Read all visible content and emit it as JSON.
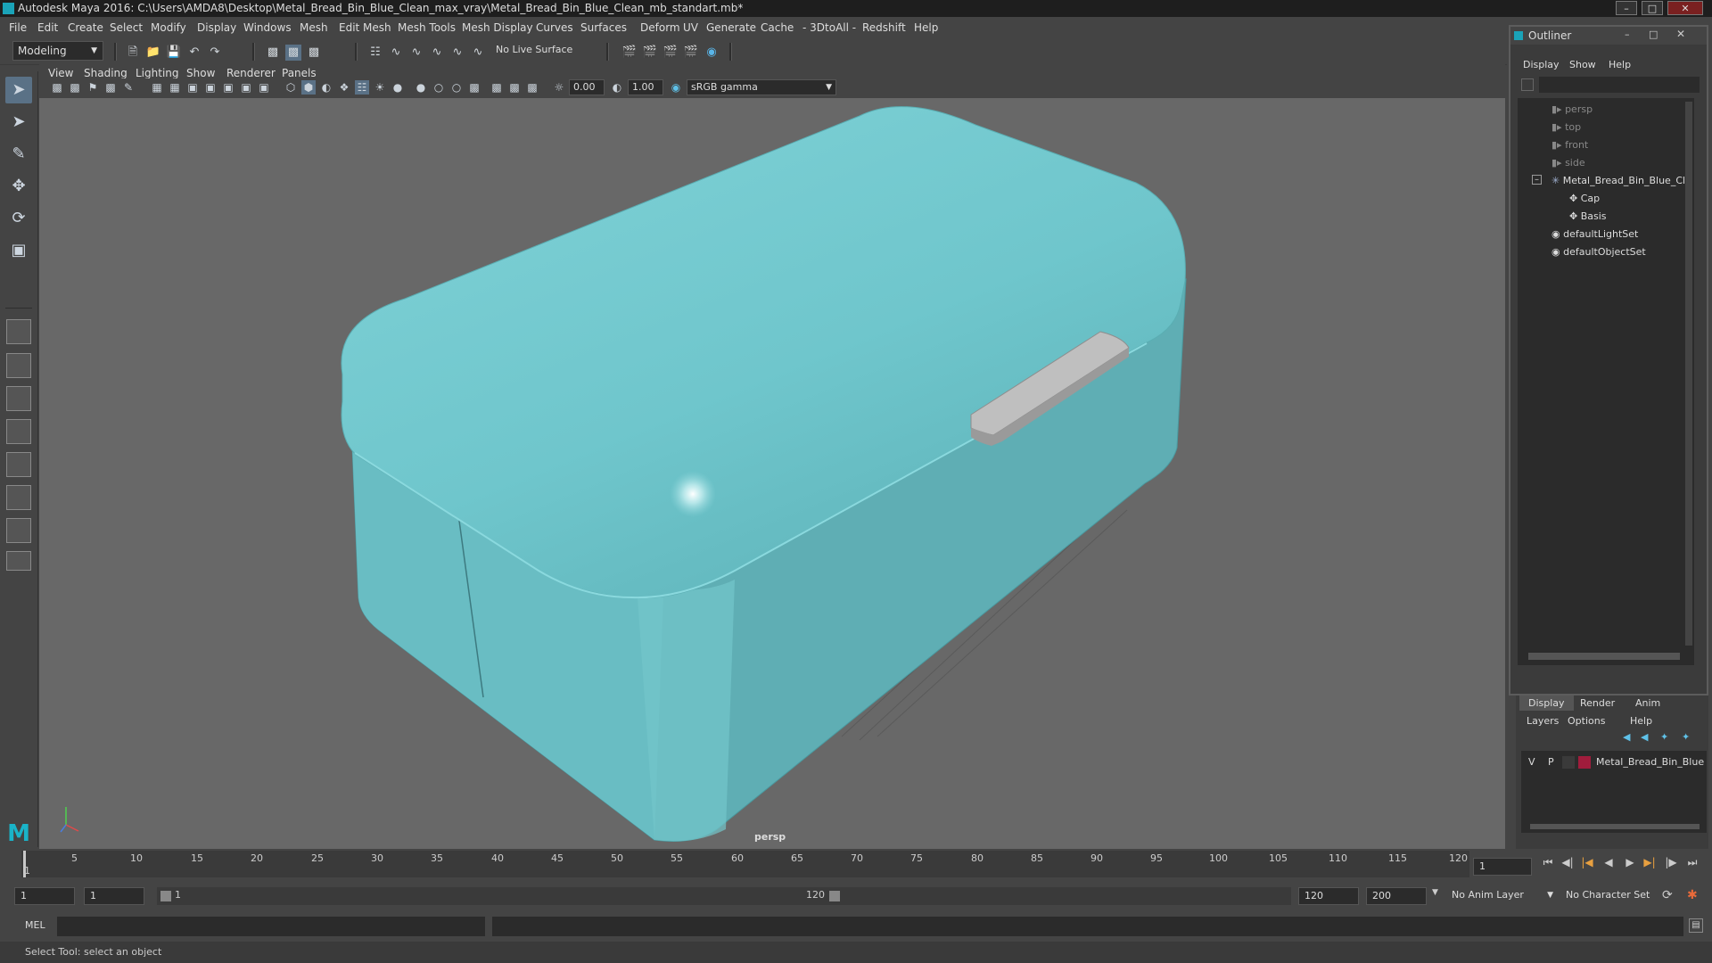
{
  "window": {
    "title": "Autodesk Maya 2016: C:\\Users\\AMDA8\\Desktop\\Metal_Bread_Bin_Blue_Clean_max_vray\\Metal_Bread_Bin_Blue_Clean_mb_standart.mb*"
  },
  "menubar": [
    "File",
    "Edit",
    "Create",
    "Select",
    "Modify",
    "Display",
    "Windows",
    "Mesh",
    "Edit Mesh",
    "Mesh Tools",
    "Mesh Display",
    "Curves",
    "Surfaces",
    "Deform",
    "UV",
    "Generate",
    "Cache",
    "- 3DtoAll -",
    "Redshift",
    "Help"
  ],
  "statusline": {
    "mode": "Modeling",
    "live_surface": "No Live Surface"
  },
  "viewport": {
    "menu": [
      "View",
      "Shading",
      "Lighting",
      "Show",
      "Renderer",
      "Panels"
    ],
    "exposure": "0.00",
    "gamma": "1.00",
    "color_space": "sRGB gamma",
    "camera_label": "persp"
  },
  "outliner": {
    "title": "Outliner",
    "menu": [
      "Display",
      "Show",
      "Help"
    ],
    "items": [
      {
        "label": "persp",
        "kind": "camera"
      },
      {
        "label": "top",
        "kind": "camera"
      },
      {
        "label": "front",
        "kind": "camera"
      },
      {
        "label": "side",
        "kind": "camera"
      },
      {
        "label": "Metal_Bread_Bin_Blue_Cl",
        "kind": "group"
      },
      {
        "label": "Cap",
        "kind": "mesh"
      },
      {
        "label": "Basis",
        "kind": "mesh"
      },
      {
        "label": "defaultLightSet",
        "kind": "set"
      },
      {
        "label": "defaultObjectSet",
        "kind": "set"
      }
    ]
  },
  "layer_editor": {
    "tabs": [
      "Display",
      "Render",
      "Anim"
    ],
    "menu": [
      "Layers",
      "Options",
      "Help"
    ],
    "layer": {
      "v": "V",
      "p": "P",
      "name": "Metal_Bread_Bin_Blue",
      "color": "#a01c3c"
    }
  },
  "timeline": {
    "ticks": [
      "5",
      "10",
      "15",
      "20",
      "25",
      "30",
      "35",
      "40",
      "45",
      "50",
      "55",
      "60",
      "65",
      "70",
      "75",
      "80",
      "85",
      "90",
      "95",
      "100",
      "105",
      "110",
      "115",
      "120"
    ],
    "start_tick": "1",
    "current_frame": "1"
  },
  "range": {
    "start": "1",
    "playback_start": "1",
    "range_start_label": "1",
    "range_end_label": "120",
    "playback_end": "120",
    "end": "200",
    "anim_layer": "No Anim Layer",
    "character_set": "No Character Set"
  },
  "command": {
    "lang": "MEL"
  },
  "help": {
    "text": "Select Tool: select an object"
  },
  "colors": {
    "model": "#6fc6cc",
    "viewport_bg": "#686868",
    "accent": "#5a7186"
  }
}
